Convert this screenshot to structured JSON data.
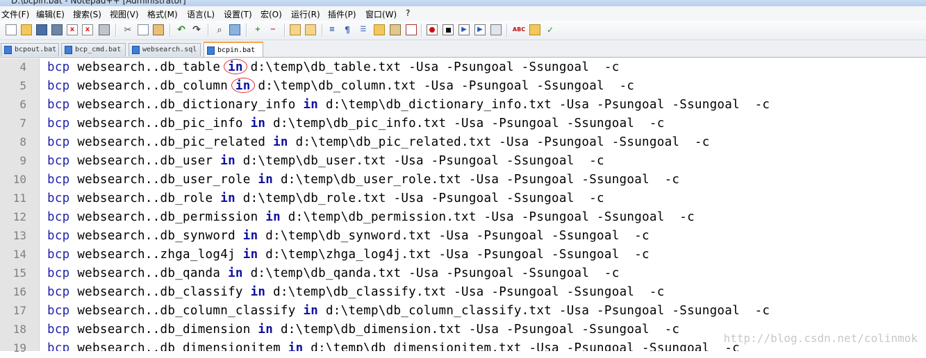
{
  "window": {
    "title": "D:\\bcpin.bat - Notepad++ [Administrator]"
  },
  "menu": [
    "文件(F)",
    "编辑(E)",
    "搜索(S)",
    "视图(V)",
    "格式(M)",
    "语言(L)",
    "设置(T)",
    "宏(O)",
    "运行(R)",
    "插件(P)",
    "窗口(W)",
    "?"
  ],
  "toolbar": {
    "icons": [
      "new-file-icon",
      "open-file-icon",
      "save-icon",
      "save-all-icon",
      "close-icon",
      "close-all-icon",
      "print-icon",
      "cut-icon",
      "copy-icon",
      "paste-icon",
      "undo-icon",
      "redo-icon",
      "find-icon",
      "replace-icon",
      "zoom-in-icon",
      "zoom-out-icon",
      "sync-vertical-icon",
      "sync-horizontal-icon",
      "word-wrap-icon",
      "show-all-chars-icon",
      "indent-guide-icon",
      "folder-icon",
      "doc-map-icon",
      "function-list-icon",
      "record-macro-icon",
      "stop-macro-icon",
      "play-macro-icon",
      "run-macro-multiple-icon",
      "save-macro-icon",
      "spell-check-icon",
      "spell-check-doc-icon",
      "spell-check-options-icon"
    ]
  },
  "tabs": [
    {
      "label": "bcpout.bat",
      "active": false
    },
    {
      "label": "bcp_cmd.bat",
      "active": false
    },
    {
      "label": "websearch.sql",
      "active": false
    },
    {
      "label": "bcpin.bat",
      "active": true
    }
  ],
  "editor": {
    "lines": [
      {
        "n": "4",
        "table": "db_table"
      },
      {
        "n": "5",
        "table": "db_column"
      },
      {
        "n": "6",
        "table": "db_dictionary_info"
      },
      {
        "n": "7",
        "table": "db_pic_info"
      },
      {
        "n": "8",
        "table": "db_pic_related"
      },
      {
        "n": "9",
        "table": "db_user"
      },
      {
        "n": "10",
        "table": "db_user_role"
      },
      {
        "n": "11",
        "table": "db_role"
      },
      {
        "n": "12",
        "table": "db_permission"
      },
      {
        "n": "13",
        "table": "db_synword"
      },
      {
        "n": "14",
        "table": "zhga_log4j"
      },
      {
        "n": "15",
        "table": "db_qanda"
      },
      {
        "n": "16",
        "table": "db_classify"
      },
      {
        "n": "17",
        "table": "db_column_classify"
      },
      {
        "n": "18",
        "table": "db_dimension"
      },
      {
        "n": "19",
        "table": "db_dimensionitem"
      }
    ],
    "prefix_kw": "bcp",
    "db_prefix": " websearch..",
    "in_kw": "in",
    "path_prefix": "d:\\temp\\",
    "suffix": ".txt -Usa -Psungoal -Ssungoal  -c"
  },
  "watermark": "http://blog.csdn.net/colinmok",
  "colors": {
    "keyword": "#1f1faa",
    "annotation_circle": "#e03030",
    "active_tab_accent": "#f7a44b"
  }
}
